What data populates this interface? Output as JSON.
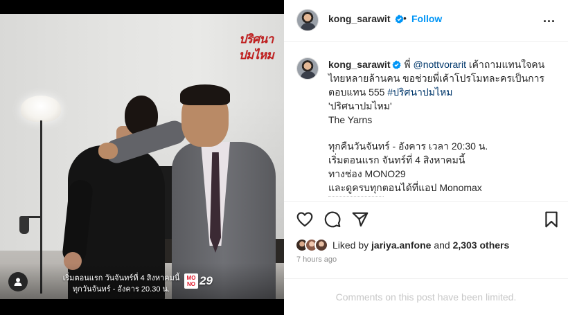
{
  "media": {
    "show_logo_line1": "ปริศนา",
    "show_logo_line2": "ปมไหม",
    "caption_line1": "เริ่มตอนแรก วันจันทร์ที่ 4 สิงหาคมนี้",
    "caption_line2": "ทุกวันจันทร์ - อังคาร 20.30 น.",
    "channel_logo_top": "MO",
    "channel_logo_bottom": "NO",
    "channel_number": "29",
    "tag_icon": "person-tag-icon"
  },
  "header": {
    "username": "kong_sarawit",
    "separator": "•",
    "follow_label": "Follow",
    "more_label": "...",
    "verified_icon": "verified-badge-icon"
  },
  "caption": {
    "username": "kong_sarawit",
    "prefix": "พี่",
    "mention": "@nottvorarit",
    "body_1": "เค้าถามแทนใจคน",
    "body_2": "ไทยหลายล้านคน ขอช่วยพี่เค้าโปรโมทละครเป็นการ",
    "body_3": "ตอบแทน 555",
    "hashtag": "#ปริศนาปมไหม",
    "line_title": "'ปริศนาปมไหม'",
    "line_studio": "The Yarns",
    "line_schedule": "ทุกคืนวันจันทร์ - อังคาร เวลา 20:30 น.",
    "line_start": "เริ่มตอนแรก จันทร์ที่ 4 สิงหาคมนี้",
    "line_channel": "ทางช่อง MONO29",
    "line_app": "และดูครบทุกตอนได้ที่แอป Monomax"
  },
  "actions": {
    "like_icon": "heart-icon",
    "comment_icon": "comment-icon",
    "share_icon": "share-icon",
    "save_icon": "bookmark-icon"
  },
  "likes": {
    "prefix": "Liked by",
    "user": "jariya.anfone",
    "connector": "and",
    "others": "2,303 others"
  },
  "timestamp": "7 hours ago",
  "comments_limited": "Comments on this post have been limited.",
  "colors": {
    "accent": "#0095f6",
    "text": "#262626",
    "muted": "#8e8e8e",
    "mention": "#00376b",
    "logo_red": "#c21f1f"
  }
}
